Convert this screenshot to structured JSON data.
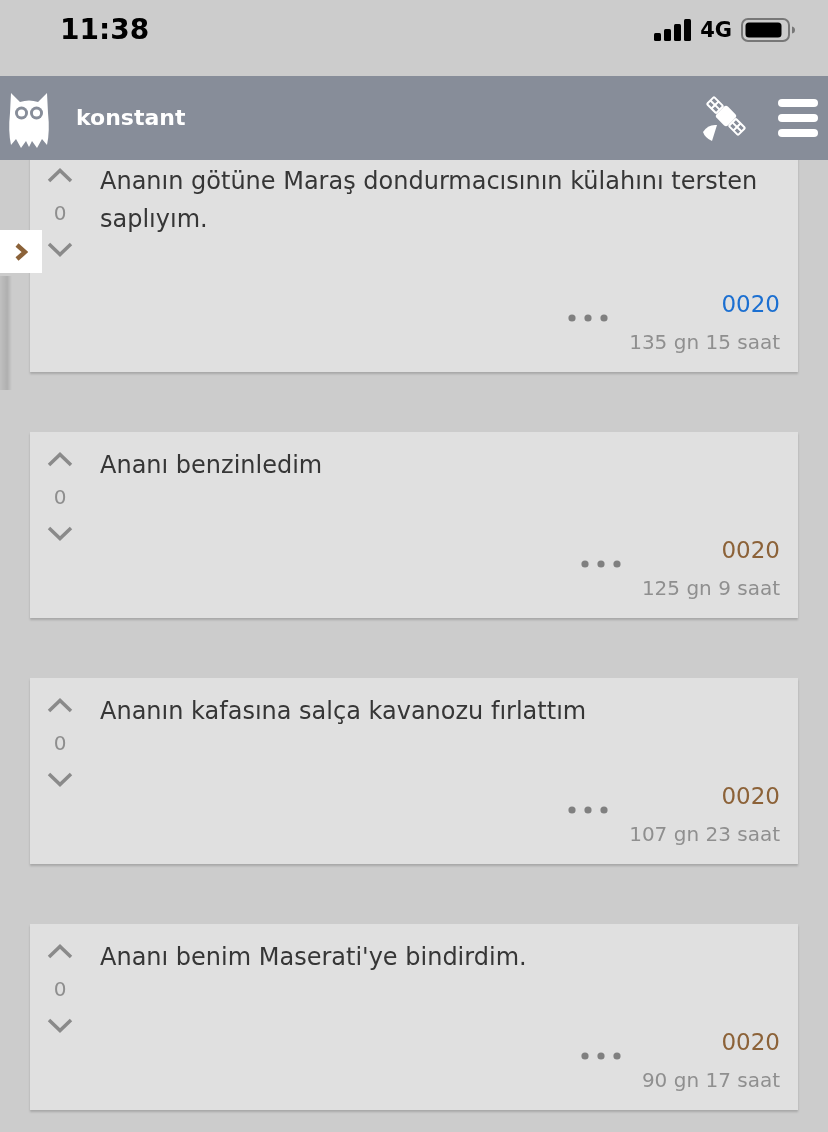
{
  "status_bar": {
    "time": "11:38",
    "network": "4G"
  },
  "header": {
    "title": "konstant"
  },
  "entries": [
    {
      "text": "Ananın götüne Maraş dondurmacısının külahını tersten saplıyım.",
      "votes": "0",
      "author": {
        "name": "0020",
        "color": "#1b6fd1"
      },
      "date": "135 gn 15 saat"
    },
    {
      "text": "Ananı benzinledim",
      "votes": "0",
      "author": {
        "name": "0020",
        "color": "#8c6238"
      },
      "date": "125 gn 9 saat"
    },
    {
      "text": "Ananın kafasına salça kavanozu fırlattım",
      "votes": "0",
      "author": {
        "name": "0020",
        "color": "#8c6238"
      },
      "date": "107 gn 23 saat"
    },
    {
      "text": "Ananı benim Maserati'ye bindirdim.",
      "votes": "0",
      "author": {
        "name": "0020",
        "color": "#8c6238"
      },
      "date": "90 gn 17 saat"
    }
  ]
}
